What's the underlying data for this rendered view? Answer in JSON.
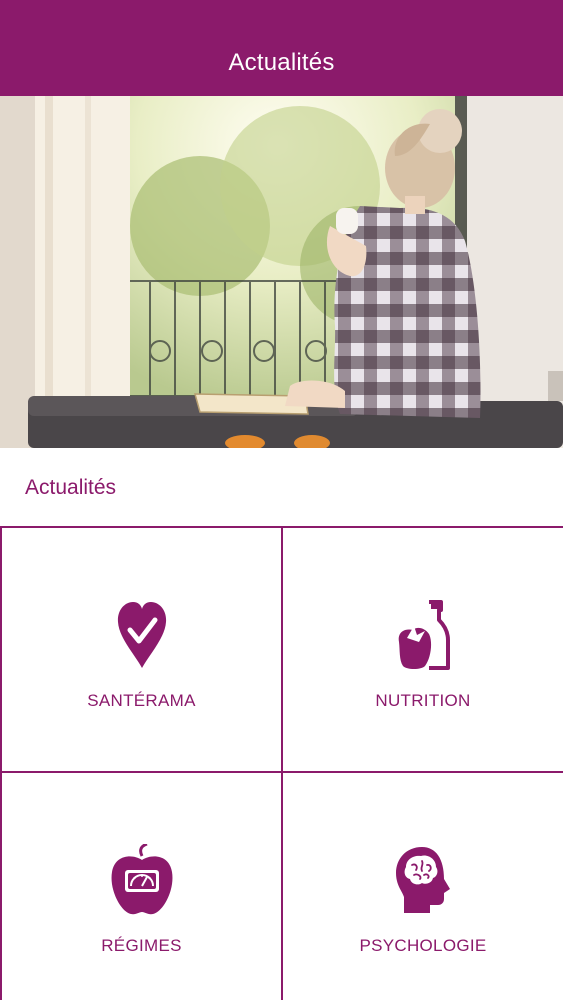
{
  "header": {
    "title": "Actualités"
  },
  "hero": {
    "image": "woman-at-window-with-cup"
  },
  "section": {
    "heading": "Actualités"
  },
  "tiles": [
    {
      "label": "SANTÉRAMA",
      "icon": "heart-check-icon"
    },
    {
      "label": "NUTRITION",
      "icon": "fruit-bottle-icon"
    },
    {
      "label": "RÉGIMES",
      "icon": "apple-scale-icon"
    },
    {
      "label": "PSYCHOLOGIE",
      "icon": "head-brain-icon"
    }
  ],
  "colors": {
    "brand": "#8b1a6b",
    "background": "#ffffff"
  }
}
